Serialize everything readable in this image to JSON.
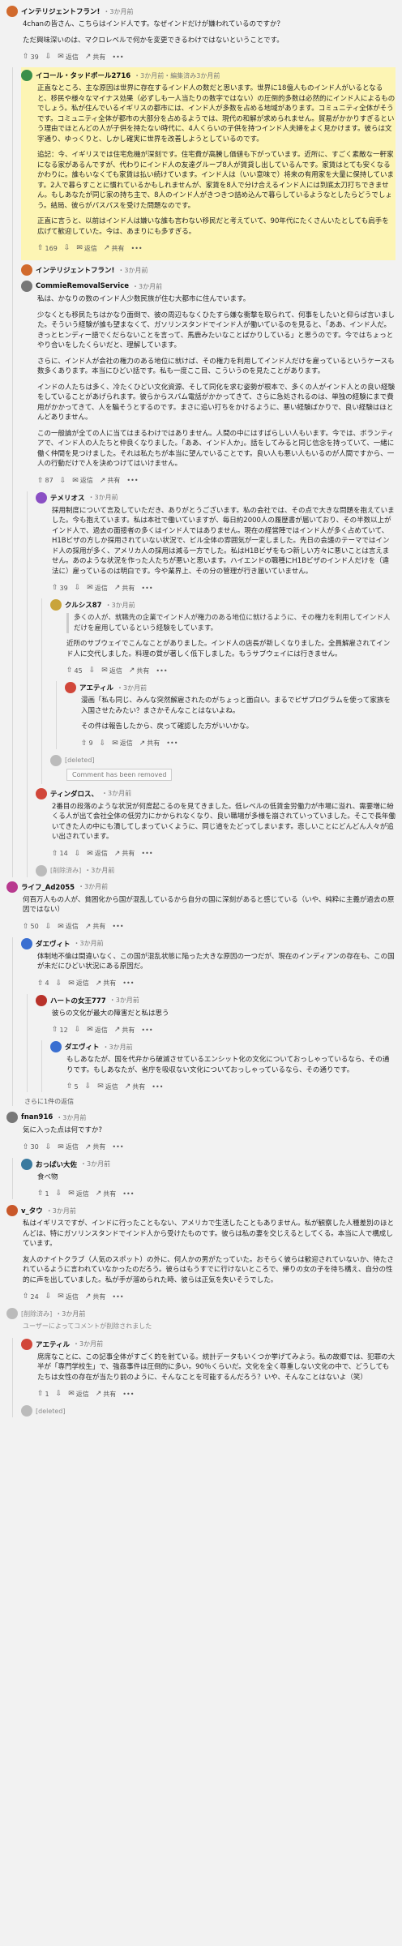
{
  "actions": {
    "reply": "返信",
    "share": "共有",
    "more": "•••"
  },
  "comments": [
    {
      "id": "c1",
      "author": "インテリジェントフラン!",
      "meta": "・3か月前",
      "color": "#d16a2d",
      "paras": [
        "4chanの皆さん、こちらはインド人です。なぜインドだけが嫌われているのですか？",
        "ただ興味深いのは、マクロレベルで何かを変更できるわけではないということです。"
      ],
      "votes": "39"
    },
    {
      "id": "c2",
      "author": "イコール・タッドボール2716",
      "meta": "・3か月前・編集済み3か月前",
      "color": "#3a8f4a",
      "highlight": true,
      "paras": [
        "正直なところ、主な原因は世界に存在するインド人の数だと思います。世界に18億人ものインド人がいるとなると、移民や様々なマイナス効果（必ずしも一人当たりの数字ではない）の圧倒的多数は必然的にインド人によるものでしょう。私が住んでいるイギリスの都市には、インド人が多数を占める地域があります。コミュニティ全体がそうです。コミュニティ全体が都市の大部分を占めるようでは、現代の和解が求められません。貿易がかかりすぎるという理由でほとんどの人が子供を持たない時代に、4人くらいの子供を持つインド人夫婦をよく見かけます。彼らは文字通り、ゆっくりと、しかし確実に世界を改善しようとしているのです。",
        "追記：今、イギリスでは住宅危機が深刻です。住宅費が高騰し価値も下がっています。近所に、すごく素敵な一軒家になる家があるんですが、代わりにインド人の友達グループ8人が賃貸し出しているんです。家賃はとても安くなるかわりに。誰もいなくても家賃は払い続けています。インド人は（いい意味で）将来の有用家を大量に保持しています。2人で暮らすことに慣れているかもしれませんが、家賃を8人で分け合えるインド人には到底太刀打ちできません。もしあなたが同じ家の持ち主で、8人のインド人がきつきつ詰め込んで暮らしているようなとしたらどうでしょう。結局、彼らがパスパスを受けた問題なのです。",
        "正直に言うと、以前はインド人は嫌いな誰も言わない移民だと考えていて、90年代にたくさんいたとしても肩手を広げて歓迎していた。今は、あまりにも多すぎる。"
      ],
      "votes": "169"
    },
    {
      "id": "c3",
      "author": "インテリジェントフラン!",
      "meta": "・3か月前",
      "color": "#d16a2d",
      "paras": []
    },
    {
      "id": "c4",
      "author": "CommieRemovalService",
      "meta": "・3か月前",
      "color": "#777",
      "paras": [
        "私は、かなりの数のインド人少数民族が住む大都市に住んでいます。",
        "少なくとも移民たちはかなり面倒で、彼の周辺もなくひたすら嫌な衝撃を取られて、何事をしたいと仰らば言いました。そういう経験が誰も望まなくて、ガソリンスタンドでインド人が働いているのを見ると、「ああ、インド人だ。きっとヒンディー語でくだらないことを言って、馬鹿みたいなことばかりしている」と思うのです。今ではちょっとやり合いをしたくらいだと、理解しています。",
        "さらに、インド人が会社の権力のある地位に就けば、その権力を利用してインド人だけを雇っているというケースも数多くあります。本当にひどい話です。私も一度ここ目、こういうのを見たことがあります。",
        "インドの人たちは多く、冷たくひどい文化資源、そして同化を求む姿勢が根本で、多くの人がインド人との良い経験をしていることがあげられます。彼らからスパム電話がかかってきて、さらに急処されるのは、単独の経験にまで費用がかかってきて、人を騙そうとするのです。まさに追い打ちをかけるように、悪い経験ばかりで、良い経験はほとんどありません。",
        "この一般論が全ての人に当てはまるわけではありません。人間の中にはすばらしい人もいます。今では、ボランティアで、インド人の人たちと仲良くなりました。「ああ、インド人か」。話をしてみると同じ信念を持っていて、一緒に働く仲間を見つけました。それは私たちが本当に望んでいることです。良い人も悪い人もいるのが人間ですから、一人の行動だけで人を決めつけてはいけません。"
      ],
      "votes": "87"
    },
    {
      "id": "c5",
      "author": "テメリオス",
      "meta": "・3か月前",
      "color": "#8a4fc4",
      "paras": [
        "採用制度について言及していただき、ありがとうございます。私の会社では、その点で大きな問題を抱えていました。今も抱えています。私は本社で働いていますが、毎日約2000人の履歴書が届いており、その半数以上がインド人で、過去の面接者の多くはインド人ではありません。現在の経営陣ではインド人が多く占めていて、H1Bビザの方しか採用されていない状況で、ビル全体の雰囲気が一変しました。先日の会議のテーマではインド人の採用が多く、アメリカ人の採用は減る一方でした。私はH1Bビザをもつ新しい方々に悪いことは言えません。あのような状況を作った人たちが悪いと思います。ハイエンドの職種にH1Bビザのインド人だけを（違法に）雇っているのは明白です。今や業界上、その分の管理が行き届いていません。"
      ],
      "votes": "39"
    },
    {
      "id": "c6",
      "author": "クルシス87",
      "meta": "・3か月前",
      "color": "#c9a43a",
      "quote": "多くの人が、就職先の企業でインド人が権力のある地位に就けるように、その権力を利用してインド人だけを雇用しているという経験をしています。",
      "paras": [
        "近所のサブウェイでこんなことがありました。インド人の店長が新しくなりました。全員解雇されてインド人に交代しました。料理の質が著しく低下しました。もうサブウェイには行きません。"
      ],
      "votes": "45"
    },
    {
      "id": "c7",
      "author": "アエティル",
      "meta": "・3か月前",
      "color": "#d1473a",
      "paras": [
        "漫画「私も同じ、みんな突然解雇されたのがちょっと面白い。まるでピザプログラムを使って家族を入国させたみたい？まさかそんなことはないよね。",
        "その件は報告したから、戻って確認した方がいいかな。"
      ],
      "votes": "9"
    },
    {
      "id": "c8",
      "author": "[deleted]",
      "meta": "",
      "color": "#bbb",
      "removed": "Comment has been removed"
    },
    {
      "id": "c9",
      "author": "ティンダロス、",
      "meta": "・3か月前",
      "color": "#d1473a",
      "paras": [
        "2番目の段落のような状況が何度起こるのを見てきました。低レベルの低賃金労働力が市場に溢れ、需要増に紛くる人が出て会社全体の低労力にかかられなくなり、良い職場が多様を崩されていっていました。そこで長年働いてきた人の中にも潰してしまっていくように、同じ道をたどってしまいます。悲しいことにどんどん人々が追い出されています。"
      ],
      "votes": "14"
    },
    {
      "id": "c10",
      "author": "[削除済み]",
      "meta": "・3か月前",
      "color": "#bbb",
      "paras": []
    },
    {
      "id": "c11",
      "author": "ライフ_Ad2055",
      "meta": "・3か月前",
      "color": "#b83a8f",
      "paras": [
        "何百万人もの人が、貧困化から国が混乱しているから自分の国に深刻があると感じている（いや、純粋に主義が過去の原因ではない）"
      ],
      "votes": "50"
    },
    {
      "id": "c12",
      "author": "ダエヴィト",
      "meta": "・3か月前",
      "color": "#3a6fd1",
      "paras": [
        "体制地不倫は間違いなく、この国が混乱状態に陥った大きな原因の一つだが、現在のインディアンの存在も、この国が未だにひどい状況にある原因だ。"
      ],
      "votes": "4"
    },
    {
      "id": "c13",
      "author": "ハートの女王777",
      "meta": "・3か月前",
      "color": "#b8322a",
      "paras": [
        "彼らの文化が最大の障害だと私は思う"
      ],
      "votes": "12"
    },
    {
      "id": "c14",
      "author": "ダエヴィト",
      "meta": "・3か月前",
      "color": "#3a6fd1",
      "paras": [
        "もしあなたが、国を代弁から破滅させているエンシット化の文化についておっしゃっているなら、その通りです。もしあなたが、省庁を吸収ない文化についておっしゃっているなら、その通りです。"
      ],
      "votes": "5"
    },
    {
      "id": "c15",
      "author": "fnan916",
      "meta": "・3か月前",
      "color": "#777",
      "paras": [
        "気に入った点は何ですか?"
      ],
      "votes": "30"
    },
    {
      "id": "c16",
      "author": "おっぱい大佐",
      "meta": "・3か月前",
      "color": "#3a7a9f",
      "paras": [
        "食べ物"
      ],
      "votes": "1"
    },
    {
      "id": "c17",
      "author": "v_タウ",
      "meta": "・3か月前",
      "color": "#c9582a",
      "paras": [
        "私はイギリスですが、インドに行ったこともない、アメリカで生活したこともありません。私が観察した人種差別のほとんどは、特にガソリンスタンドでインド人から受けたものです。彼らは私の妻を交じえるとしてくる。本当に人で構成しています。",
        "友人のナイトクラブ（人気のスポット）の外に、何人かの男がたっていた。おそらく彼らは歓迎されていないか、待たされているように言われていなかったのだろう。彼らはもうすでに行けないところで、帰りの女の子を待ち構え、自分の性的に声を出していました。私が手が溜められた時、彼らは正気を失いそうでした。"
      ],
      "votes": "24"
    },
    {
      "id": "c18",
      "author": "[削除済み]",
      "meta": "・3か月前",
      "color": "#bbb",
      "paras": [
        "ユーザーによってコメントが削除されました"
      ],
      "votes": ""
    },
    {
      "id": "c19",
      "author": "アエティル",
      "meta": "・3か月前",
      "color": "#d1473a",
      "paras": [
        "席席なことに、この記事全体がすごく的を射ている。統計データもいくつか挙げてみよう。私の故郷では、犯罪の大半が「専門学校生」で、強姦事件は圧倒的に多い。90％くらいだ。文化を全く尊重しない文化の中で、どうしてもたちは女性の存在が当たり前のように、そんなことを可能するんだろう？いや、そんなことはないよ（笑）"
      ],
      "votes": "1"
    },
    {
      "id": "c20",
      "author": "[deleted]",
      "meta": "",
      "color": "#bbb",
      "paras": []
    }
  ],
  "labels": {
    "more_replies": "さらに1件の返信"
  }
}
